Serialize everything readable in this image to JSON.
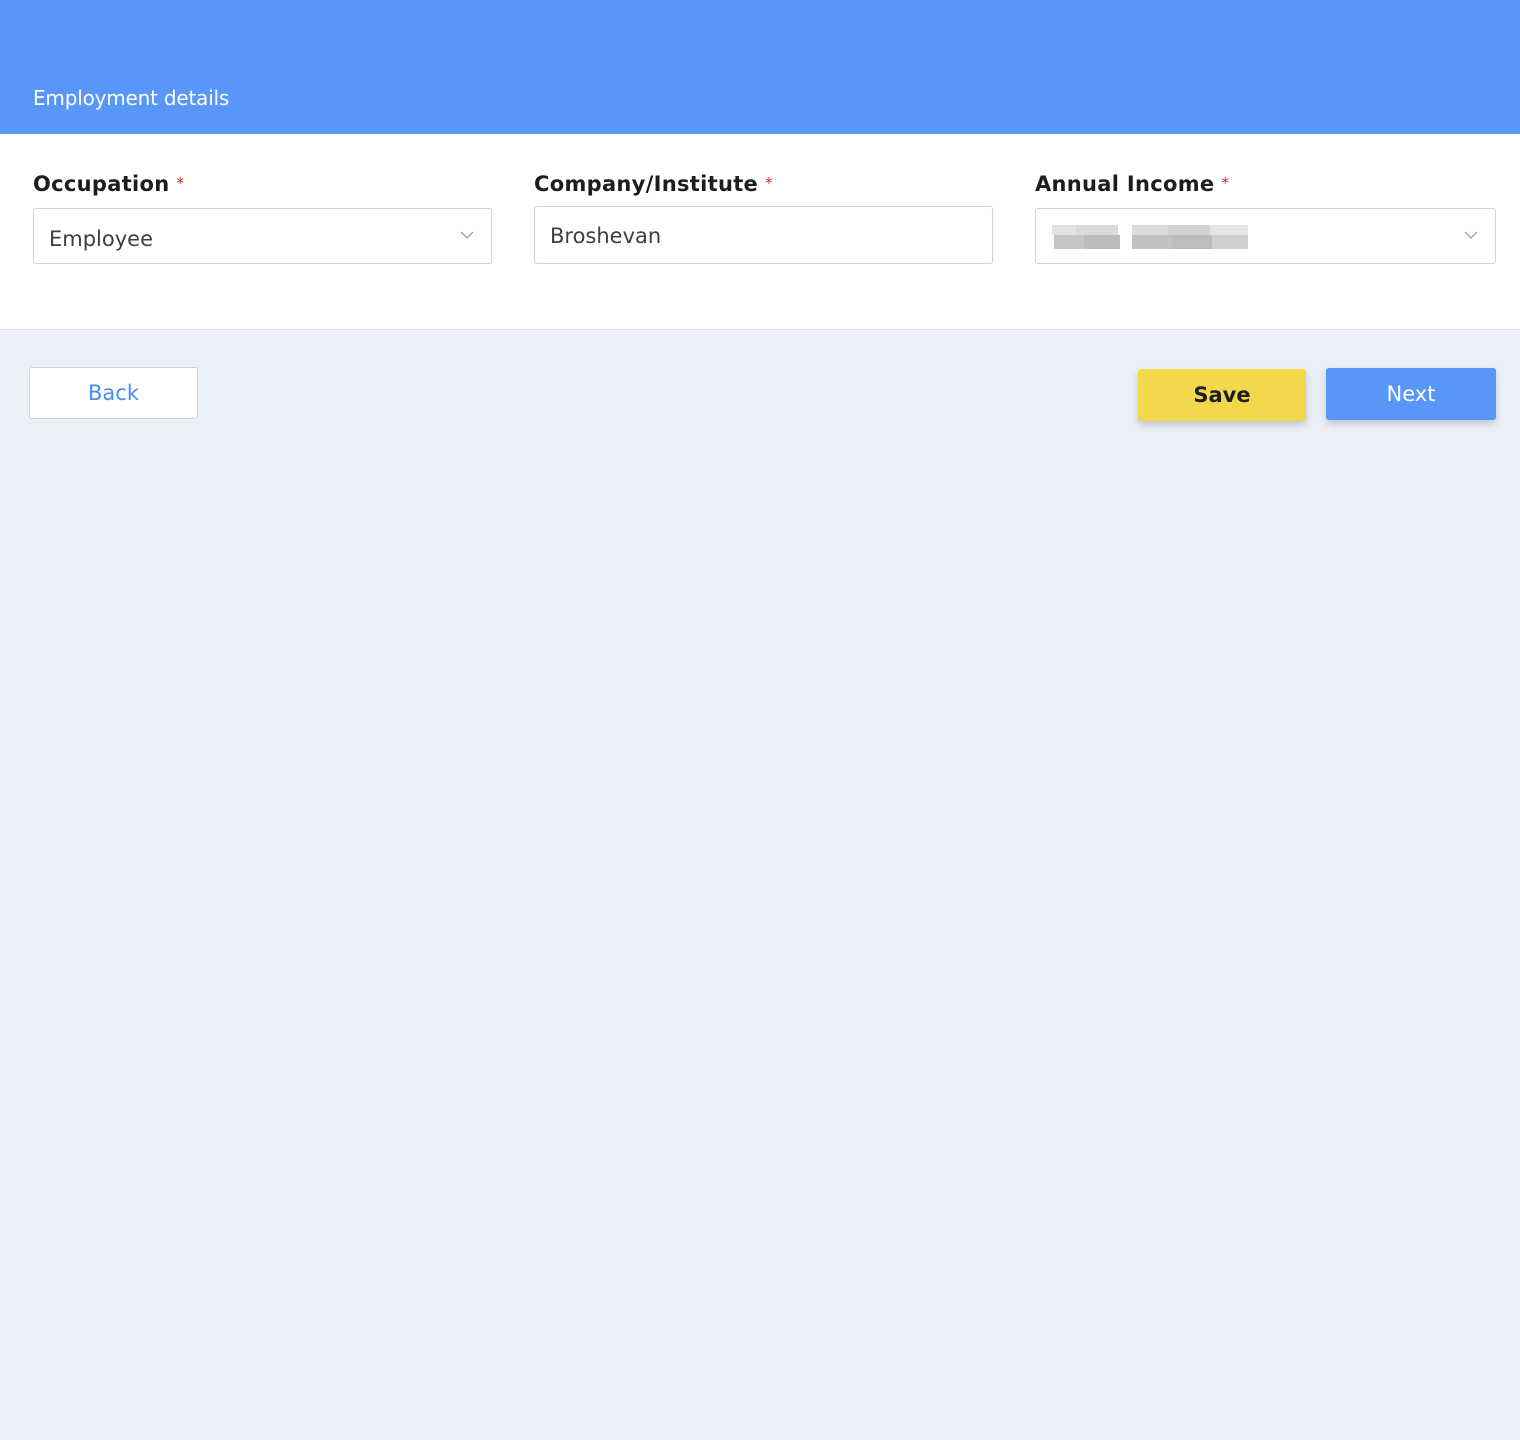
{
  "header": {
    "title": "Employment details"
  },
  "form": {
    "occupation": {
      "label": "Occupation",
      "required_mark": "*",
      "value": "Employee"
    },
    "company": {
      "label": "Company/Institute",
      "required_mark": "*",
      "value": "Broshevan"
    },
    "annual_income": {
      "label": "Annual Income",
      "required_mark": "*"
    }
  },
  "actions": {
    "back_label": "Back",
    "save_label": "Save",
    "next_label": "Next"
  },
  "colors": {
    "primary": "#5896f8",
    "save": "#f2d84a",
    "required": "#d6242a",
    "background": "#ebf0f7"
  }
}
